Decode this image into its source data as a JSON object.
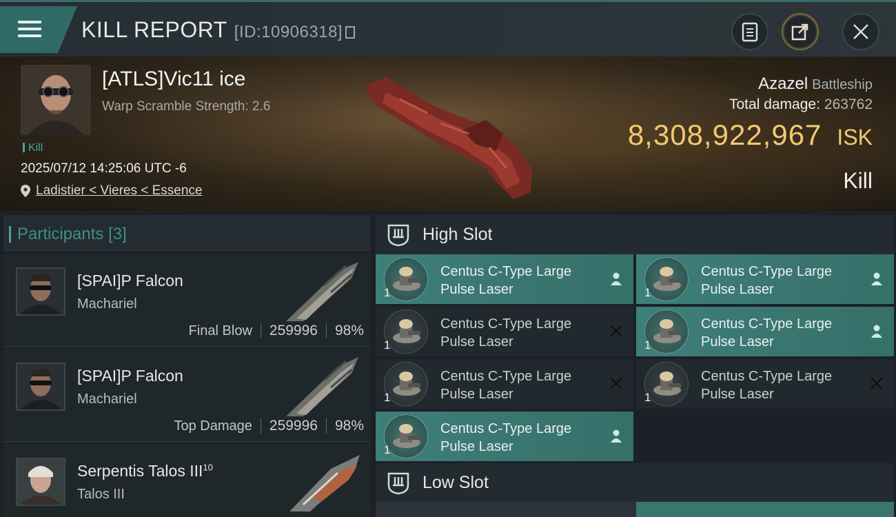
{
  "header": {
    "title": "KILL REPORT",
    "report_id": "[ID:10906318]"
  },
  "victim": {
    "pilot": "[ATLS]Vic11 ice",
    "scramble": "Warp Scramble Strength: 2.6",
    "type_tag": "Kill",
    "datetime": "2025/07/12 14:25:06 UTC -6",
    "location": "Ladistier < Vieres < Essence",
    "ship": "Azazel",
    "ship_class": "Battleship",
    "total_damage_label": "Total damage:",
    "total_damage": "263762",
    "isk_value": "8,308,922,967",
    "isk_unit": "ISK",
    "result": "Kill"
  },
  "participants": {
    "label": "Participants",
    "count": "[3]",
    "items": [
      {
        "name": "[SPAI]P Falcon",
        "sup": "",
        "ship": "Machariel",
        "role": "Final Blow",
        "damage": "259996",
        "percent": "98%"
      },
      {
        "name": "[SPAI]P Falcon",
        "sup": "",
        "ship": "Machariel",
        "role": "Top Damage",
        "damage": "259996",
        "percent": "98%"
      },
      {
        "name": "Serpentis Talos III",
        "sup": "10",
        "ship": "Talos III",
        "role": "",
        "damage": "",
        "percent": ""
      }
    ]
  },
  "slots": {
    "high_label": "High Slot",
    "low_label": "Low Slot",
    "high_modules": [
      {
        "line1": "Centus C-Type Large",
        "line2": "Pulse Laser",
        "qty": "1",
        "state": "fitted"
      },
      {
        "line1": "Centus C-Type Large",
        "line2": "Pulse Laser",
        "qty": "1",
        "state": "fitted"
      },
      {
        "line1": "Centus C-Type Large",
        "line2": "Pulse Laser",
        "qty": "1",
        "state": "destroyed"
      },
      {
        "line1": "Centus C-Type Large",
        "line2": "Pulse Laser",
        "qty": "1",
        "state": "fitted"
      },
      {
        "line1": "Centus C-Type Large",
        "line2": "Pulse Laser",
        "qty": "1",
        "state": "destroyed"
      },
      {
        "line1": "Centus C-Type Large",
        "line2": "Pulse Laser",
        "qty": "1",
        "state": "destroyed"
      },
      {
        "line1": "Centus C-Type Large",
        "line2": "Pulse Laser",
        "qty": "1",
        "state": "fitted"
      }
    ]
  },
  "colors": {
    "accent_teal": "#3e7f7a",
    "isk_gold": "#f3c971",
    "background": "#1b2126"
  },
  "icons": [
    "hamburger-menu-icon",
    "copy-icon",
    "clipboard-icon",
    "share-icon",
    "close-icon",
    "location-pin-icon",
    "high-slot-icon",
    "low-slot-icon",
    "pilot-icon",
    "destroyed-x-icon"
  ]
}
